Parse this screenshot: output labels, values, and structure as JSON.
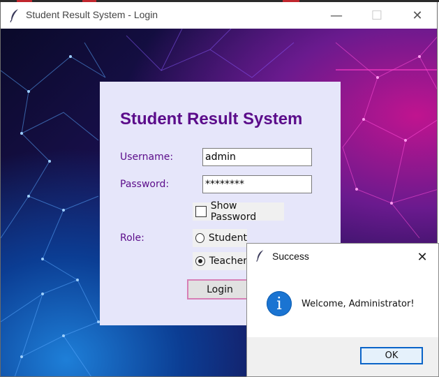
{
  "window": {
    "title": "Student Result System - Login",
    "controls": {
      "minimize": "—",
      "maximize": "☐",
      "close": "✕"
    }
  },
  "login": {
    "heading": "Student Result System",
    "username_label": "Username:",
    "username_value": "admin",
    "password_label": "Password:",
    "password_value": "********",
    "show_password_label": "Show Password",
    "show_password_checked": false,
    "role_label": "Role:",
    "roles": [
      {
        "label": "Student",
        "selected": false
      },
      {
        "label": "Teacher",
        "selected": true
      }
    ],
    "login_button": "Login"
  },
  "dialog": {
    "title": "Success",
    "close": "✕",
    "icon": "info-icon",
    "icon_glyph": "i",
    "message": "Welcome, Administrator!",
    "ok_button": "OK"
  },
  "colors": {
    "accent_text": "#5b0c8a",
    "panel_bg": "#e6e6fa",
    "login_button_border": "#d77fb5",
    "ok_button_border": "#0a64c8",
    "info_icon": "#1a74d2"
  }
}
